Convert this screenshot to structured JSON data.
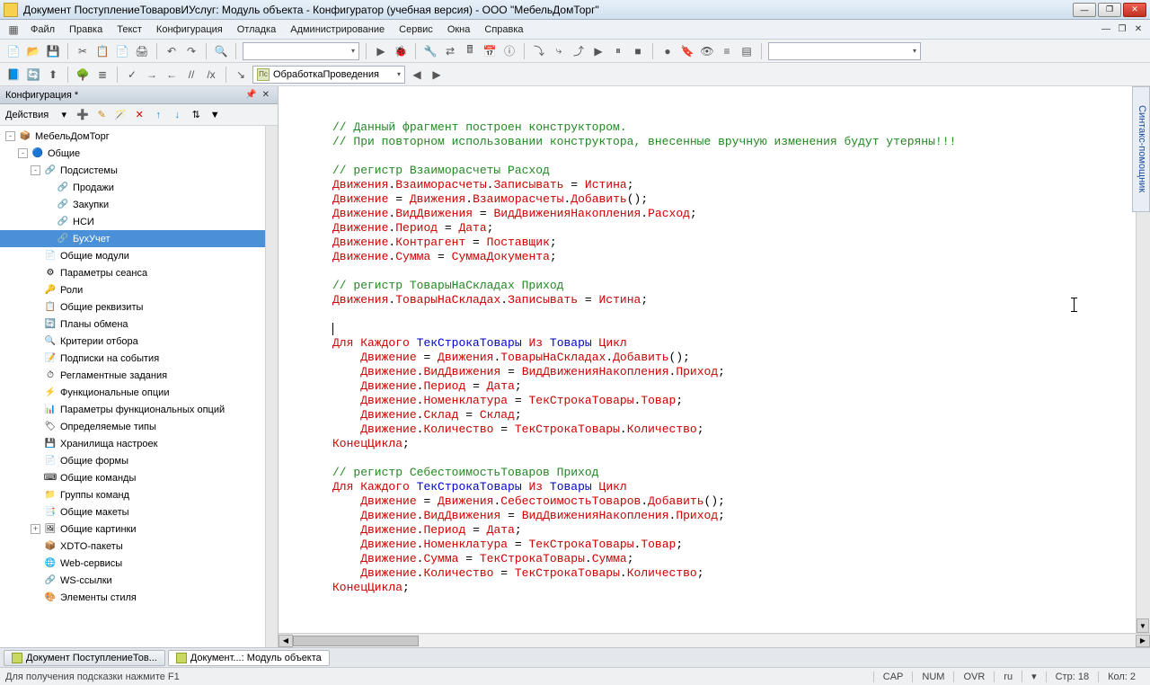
{
  "window": {
    "title": "Документ ПоступлениеТоваровИУслуг: Модуль объекта - Конфигуратор (учебная версия) - ООО \"МебельДомТорг\""
  },
  "menu": [
    "Файл",
    "Правка",
    "Текст",
    "Конфигурация",
    "Отладка",
    "Администрирование",
    "Сервис",
    "Окна",
    "Справка"
  ],
  "toolbar2": {
    "proc_combo": "ОбработкаПроведения"
  },
  "config_panel": {
    "title": "Конфигурация *",
    "actions_label": "Действия",
    "tree": [
      {
        "ind": 1,
        "exp": "-",
        "ico": "📦",
        "lbl": "МебельДомТорг"
      },
      {
        "ind": 2,
        "exp": "-",
        "ico": "🔵",
        "lbl": "Общие"
      },
      {
        "ind": 3,
        "exp": "-",
        "ico": "🔗",
        "lbl": "Подсистемы"
      },
      {
        "ind": 4,
        "exp": " ",
        "ico": "🔗",
        "lbl": "Продажи"
      },
      {
        "ind": 4,
        "exp": " ",
        "ico": "🔗",
        "lbl": "Закупки"
      },
      {
        "ind": 4,
        "exp": " ",
        "ico": "🔗",
        "lbl": "НСИ"
      },
      {
        "ind": 4,
        "exp": " ",
        "ico": "🔗",
        "lbl": "БухУчет",
        "sel": true
      },
      {
        "ind": 3,
        "exp": " ",
        "ico": "📄",
        "lbl": "Общие модули"
      },
      {
        "ind": 3,
        "exp": " ",
        "ico": "⚙",
        "lbl": "Параметры сеанса"
      },
      {
        "ind": 3,
        "exp": " ",
        "ico": "🔑",
        "lbl": "Роли"
      },
      {
        "ind": 3,
        "exp": " ",
        "ico": "📋",
        "lbl": "Общие реквизиты"
      },
      {
        "ind": 3,
        "exp": " ",
        "ico": "🔄",
        "lbl": "Планы обмена"
      },
      {
        "ind": 3,
        "exp": " ",
        "ico": "🔍",
        "lbl": "Критерии отбора"
      },
      {
        "ind": 3,
        "exp": " ",
        "ico": "📝",
        "lbl": "Подписки на события"
      },
      {
        "ind": 3,
        "exp": " ",
        "ico": "⏱",
        "lbl": "Регламентные задания"
      },
      {
        "ind": 3,
        "exp": " ",
        "ico": "⚡",
        "lbl": "Функциональные опции"
      },
      {
        "ind": 3,
        "exp": " ",
        "ico": "📊",
        "lbl": "Параметры функциональных опций"
      },
      {
        "ind": 3,
        "exp": " ",
        "ico": "🏷",
        "lbl": "Определяемые типы"
      },
      {
        "ind": 3,
        "exp": " ",
        "ico": "💾",
        "lbl": "Хранилища настроек"
      },
      {
        "ind": 3,
        "exp": " ",
        "ico": "📄",
        "lbl": "Общие формы"
      },
      {
        "ind": 3,
        "exp": " ",
        "ico": "⌨",
        "lbl": "Общие команды"
      },
      {
        "ind": 3,
        "exp": " ",
        "ico": "📁",
        "lbl": "Группы команд"
      },
      {
        "ind": 3,
        "exp": " ",
        "ico": "📑",
        "lbl": "Общие макеты"
      },
      {
        "ind": 3,
        "exp": "+",
        "ico": "🖼",
        "lbl": "Общие картинки"
      },
      {
        "ind": 3,
        "exp": " ",
        "ico": "📦",
        "lbl": "XDTO-пакеты"
      },
      {
        "ind": 3,
        "exp": " ",
        "ico": "🌐",
        "lbl": "Web-сервисы"
      },
      {
        "ind": 3,
        "exp": " ",
        "ico": "🔗",
        "lbl": "WS-ссылки"
      },
      {
        "ind": 3,
        "exp": " ",
        "ico": "🎨",
        "lbl": "Элементы стиля"
      }
    ]
  },
  "code": [
    {
      "t": "comment",
      "s": "// Данный фрагмент построен конструктором."
    },
    {
      "t": "comment",
      "s": "// При повторном использовании конструктора, внесенные вручную изменения будут утеряны!!!"
    },
    {
      "t": "blank",
      "s": ""
    },
    {
      "t": "comment",
      "s": "// регистр Взаиморасчеты Расход"
    },
    {
      "t": "mixed",
      "parts": [
        {
          "c": "k",
          "s": "Движения"
        },
        {
          "c": "",
          "s": "."
        },
        {
          "c": "k",
          "s": "Взаиморасчеты"
        },
        {
          "c": "",
          "s": "."
        },
        {
          "c": "k",
          "s": "Записывать"
        },
        {
          "c": "",
          "s": " = "
        },
        {
          "c": "k",
          "s": "Истина"
        },
        {
          "c": "",
          "s": ";"
        }
      ]
    },
    {
      "t": "mixed",
      "parts": [
        {
          "c": "k",
          "s": "Движение"
        },
        {
          "c": "",
          "s": " = "
        },
        {
          "c": "k",
          "s": "Движения"
        },
        {
          "c": "",
          "s": "."
        },
        {
          "c": "k",
          "s": "Взаиморасчеты"
        },
        {
          "c": "",
          "s": "."
        },
        {
          "c": "k",
          "s": "Добавить"
        },
        {
          "c": "",
          "s": "();"
        }
      ]
    },
    {
      "t": "mixed",
      "parts": [
        {
          "c": "k",
          "s": "Движение"
        },
        {
          "c": "",
          "s": "."
        },
        {
          "c": "k",
          "s": "ВидДвижения"
        },
        {
          "c": "",
          "s": " = "
        },
        {
          "c": "k",
          "s": "ВидДвиженияНакопления"
        },
        {
          "c": "",
          "s": "."
        },
        {
          "c": "k",
          "s": "Расход"
        },
        {
          "c": "",
          "s": ";"
        }
      ]
    },
    {
      "t": "mixed",
      "parts": [
        {
          "c": "k",
          "s": "Движение"
        },
        {
          "c": "",
          "s": "."
        },
        {
          "c": "k",
          "s": "Период"
        },
        {
          "c": "",
          "s": " = "
        },
        {
          "c": "k",
          "s": "Дата"
        },
        {
          "c": "",
          "s": ";"
        }
      ]
    },
    {
      "t": "mixed",
      "parts": [
        {
          "c": "k",
          "s": "Движение"
        },
        {
          "c": "",
          "s": "."
        },
        {
          "c": "k",
          "s": "Контрагент"
        },
        {
          "c": "",
          "s": " = "
        },
        {
          "c": "k",
          "s": "Поставщик"
        },
        {
          "c": "",
          "s": ";"
        }
      ]
    },
    {
      "t": "mixed",
      "parts": [
        {
          "c": "k",
          "s": "Движение"
        },
        {
          "c": "",
          "s": "."
        },
        {
          "c": "k",
          "s": "Сумма"
        },
        {
          "c": "",
          "s": " = "
        },
        {
          "c": "k",
          "s": "СуммаДокумента"
        },
        {
          "c": "",
          "s": ";"
        }
      ]
    },
    {
      "t": "blank",
      "s": ""
    },
    {
      "t": "comment",
      "s": "// регистр ТоварыНаСкладах Приход"
    },
    {
      "t": "mixed",
      "parts": [
        {
          "c": "k",
          "s": "Движения"
        },
        {
          "c": "",
          "s": "."
        },
        {
          "c": "k",
          "s": "ТоварыНаСкладах"
        },
        {
          "c": "",
          "s": "."
        },
        {
          "c": "k",
          "s": "Записывать"
        },
        {
          "c": "",
          "s": " = "
        },
        {
          "c": "k",
          "s": "Истина"
        },
        {
          "c": "",
          "s": ";"
        }
      ]
    },
    {
      "t": "blank",
      "s": ""
    },
    {
      "t": "cursor",
      "s": ""
    },
    {
      "t": "mixed",
      "parts": [
        {
          "c": "k",
          "s": "Для Каждого"
        },
        {
          "c": "",
          "s": " "
        },
        {
          "c": "id",
          "s": "ТекСтрокаТовары"
        },
        {
          "c": "",
          "s": " "
        },
        {
          "c": "k",
          "s": "Из"
        },
        {
          "c": "",
          "s": " "
        },
        {
          "c": "id",
          "s": "Товары"
        },
        {
          "c": "",
          "s": " "
        },
        {
          "c": "k",
          "s": "Цикл"
        }
      ]
    },
    {
      "t": "mixed",
      "indent": "    ",
      "parts": [
        {
          "c": "k",
          "s": "Движение"
        },
        {
          "c": "",
          "s": " = "
        },
        {
          "c": "k",
          "s": "Движения"
        },
        {
          "c": "",
          "s": "."
        },
        {
          "c": "k",
          "s": "ТоварыНаСкладах"
        },
        {
          "c": "",
          "s": "."
        },
        {
          "c": "k",
          "s": "Добавить"
        },
        {
          "c": "",
          "s": "();"
        }
      ]
    },
    {
      "t": "mixed",
      "indent": "    ",
      "parts": [
        {
          "c": "k",
          "s": "Движение"
        },
        {
          "c": "",
          "s": "."
        },
        {
          "c": "k",
          "s": "ВидДвижения"
        },
        {
          "c": "",
          "s": " = "
        },
        {
          "c": "k",
          "s": "ВидДвиженияНакопления"
        },
        {
          "c": "",
          "s": "."
        },
        {
          "c": "k",
          "s": "Приход"
        },
        {
          "c": "",
          "s": ";"
        }
      ]
    },
    {
      "t": "mixed",
      "indent": "    ",
      "parts": [
        {
          "c": "k",
          "s": "Движение"
        },
        {
          "c": "",
          "s": "."
        },
        {
          "c": "k",
          "s": "Период"
        },
        {
          "c": "",
          "s": " = "
        },
        {
          "c": "k",
          "s": "Дата"
        },
        {
          "c": "",
          "s": ";"
        }
      ]
    },
    {
      "t": "mixed",
      "indent": "    ",
      "parts": [
        {
          "c": "k",
          "s": "Движение"
        },
        {
          "c": "",
          "s": "."
        },
        {
          "c": "k",
          "s": "Номенклатура"
        },
        {
          "c": "",
          "s": " = "
        },
        {
          "c": "k",
          "s": "ТекСтрокаТовары"
        },
        {
          "c": "",
          "s": "."
        },
        {
          "c": "k",
          "s": "Товар"
        },
        {
          "c": "",
          "s": ";"
        }
      ]
    },
    {
      "t": "mixed",
      "indent": "    ",
      "parts": [
        {
          "c": "k",
          "s": "Движение"
        },
        {
          "c": "",
          "s": "."
        },
        {
          "c": "k",
          "s": "Склад"
        },
        {
          "c": "",
          "s": " = "
        },
        {
          "c": "k",
          "s": "Склад"
        },
        {
          "c": "",
          "s": ";"
        }
      ]
    },
    {
      "t": "mixed",
      "indent": "    ",
      "parts": [
        {
          "c": "k",
          "s": "Движение"
        },
        {
          "c": "",
          "s": "."
        },
        {
          "c": "k",
          "s": "Количество"
        },
        {
          "c": "",
          "s": " = "
        },
        {
          "c": "k",
          "s": "ТекСтрокаТовары"
        },
        {
          "c": "",
          "s": "."
        },
        {
          "c": "k",
          "s": "Количество"
        },
        {
          "c": "",
          "s": ";"
        }
      ]
    },
    {
      "t": "mixed",
      "parts": [
        {
          "c": "k",
          "s": "КонецЦикла"
        },
        {
          "c": "",
          "s": ";"
        }
      ]
    },
    {
      "t": "blank",
      "s": ""
    },
    {
      "t": "comment",
      "s": "// регистр СебестоимостьТоваров Приход"
    },
    {
      "t": "mixed",
      "parts": [
        {
          "c": "k",
          "s": "Для Каждого"
        },
        {
          "c": "",
          "s": " "
        },
        {
          "c": "id",
          "s": "ТекСтрокаТовары"
        },
        {
          "c": "",
          "s": " "
        },
        {
          "c": "k",
          "s": "Из"
        },
        {
          "c": "",
          "s": " "
        },
        {
          "c": "id",
          "s": "Товары"
        },
        {
          "c": "",
          "s": " "
        },
        {
          "c": "k",
          "s": "Цикл"
        }
      ]
    },
    {
      "t": "mixed",
      "indent": "    ",
      "parts": [
        {
          "c": "k",
          "s": "Движение"
        },
        {
          "c": "",
          "s": " = "
        },
        {
          "c": "k",
          "s": "Движения"
        },
        {
          "c": "",
          "s": "."
        },
        {
          "c": "k",
          "s": "СебестоимостьТоваров"
        },
        {
          "c": "",
          "s": "."
        },
        {
          "c": "k",
          "s": "Добавить"
        },
        {
          "c": "",
          "s": "();"
        }
      ]
    },
    {
      "t": "mixed",
      "indent": "    ",
      "parts": [
        {
          "c": "k",
          "s": "Движение"
        },
        {
          "c": "",
          "s": "."
        },
        {
          "c": "k",
          "s": "ВидДвижения"
        },
        {
          "c": "",
          "s": " = "
        },
        {
          "c": "k",
          "s": "ВидДвиженияНакопления"
        },
        {
          "c": "",
          "s": "."
        },
        {
          "c": "k",
          "s": "Приход"
        },
        {
          "c": "",
          "s": ";"
        }
      ]
    },
    {
      "t": "mixed",
      "indent": "    ",
      "parts": [
        {
          "c": "k",
          "s": "Движение"
        },
        {
          "c": "",
          "s": "."
        },
        {
          "c": "k",
          "s": "Период"
        },
        {
          "c": "",
          "s": " = "
        },
        {
          "c": "k",
          "s": "Дата"
        },
        {
          "c": "",
          "s": ";"
        }
      ]
    },
    {
      "t": "mixed",
      "indent": "    ",
      "parts": [
        {
          "c": "k",
          "s": "Движение"
        },
        {
          "c": "",
          "s": "."
        },
        {
          "c": "k",
          "s": "Номенклатура"
        },
        {
          "c": "",
          "s": " = "
        },
        {
          "c": "k",
          "s": "ТекСтрокаТовары"
        },
        {
          "c": "",
          "s": "."
        },
        {
          "c": "k",
          "s": "Товар"
        },
        {
          "c": "",
          "s": ";"
        }
      ]
    },
    {
      "t": "mixed",
      "indent": "    ",
      "parts": [
        {
          "c": "k",
          "s": "Движение"
        },
        {
          "c": "",
          "s": "."
        },
        {
          "c": "k",
          "s": "Сумма"
        },
        {
          "c": "",
          "s": " = "
        },
        {
          "c": "k",
          "s": "ТекСтрокаТовары"
        },
        {
          "c": "",
          "s": "."
        },
        {
          "c": "k",
          "s": "Сумма"
        },
        {
          "c": "",
          "s": ";"
        }
      ]
    },
    {
      "t": "mixed",
      "indent": "    ",
      "parts": [
        {
          "c": "k",
          "s": "Движение"
        },
        {
          "c": "",
          "s": "."
        },
        {
          "c": "k",
          "s": "Количество"
        },
        {
          "c": "",
          "s": " = "
        },
        {
          "c": "k",
          "s": "ТекСтрокаТовары"
        },
        {
          "c": "",
          "s": "."
        },
        {
          "c": "k",
          "s": "Количество"
        },
        {
          "c": "",
          "s": ";"
        }
      ]
    },
    {
      "t": "mixed",
      "parts": [
        {
          "c": "k",
          "s": "КонецЦикла"
        },
        {
          "c": "",
          "s": ";"
        }
      ]
    }
  ],
  "side_tab": "Синтакс-помощник",
  "bottom_tabs": [
    {
      "lbl": "Документ ПоступлениеТов..."
    },
    {
      "lbl": "Документ...: Модуль объекта",
      "active": true
    }
  ],
  "status": {
    "hint": "Для получения подсказки нажмите F1",
    "cap": "CAP",
    "num": "NUM",
    "ovr": "OVR",
    "lang": "ru",
    "line": "Стр: 18",
    "col": "Кол: 2"
  }
}
